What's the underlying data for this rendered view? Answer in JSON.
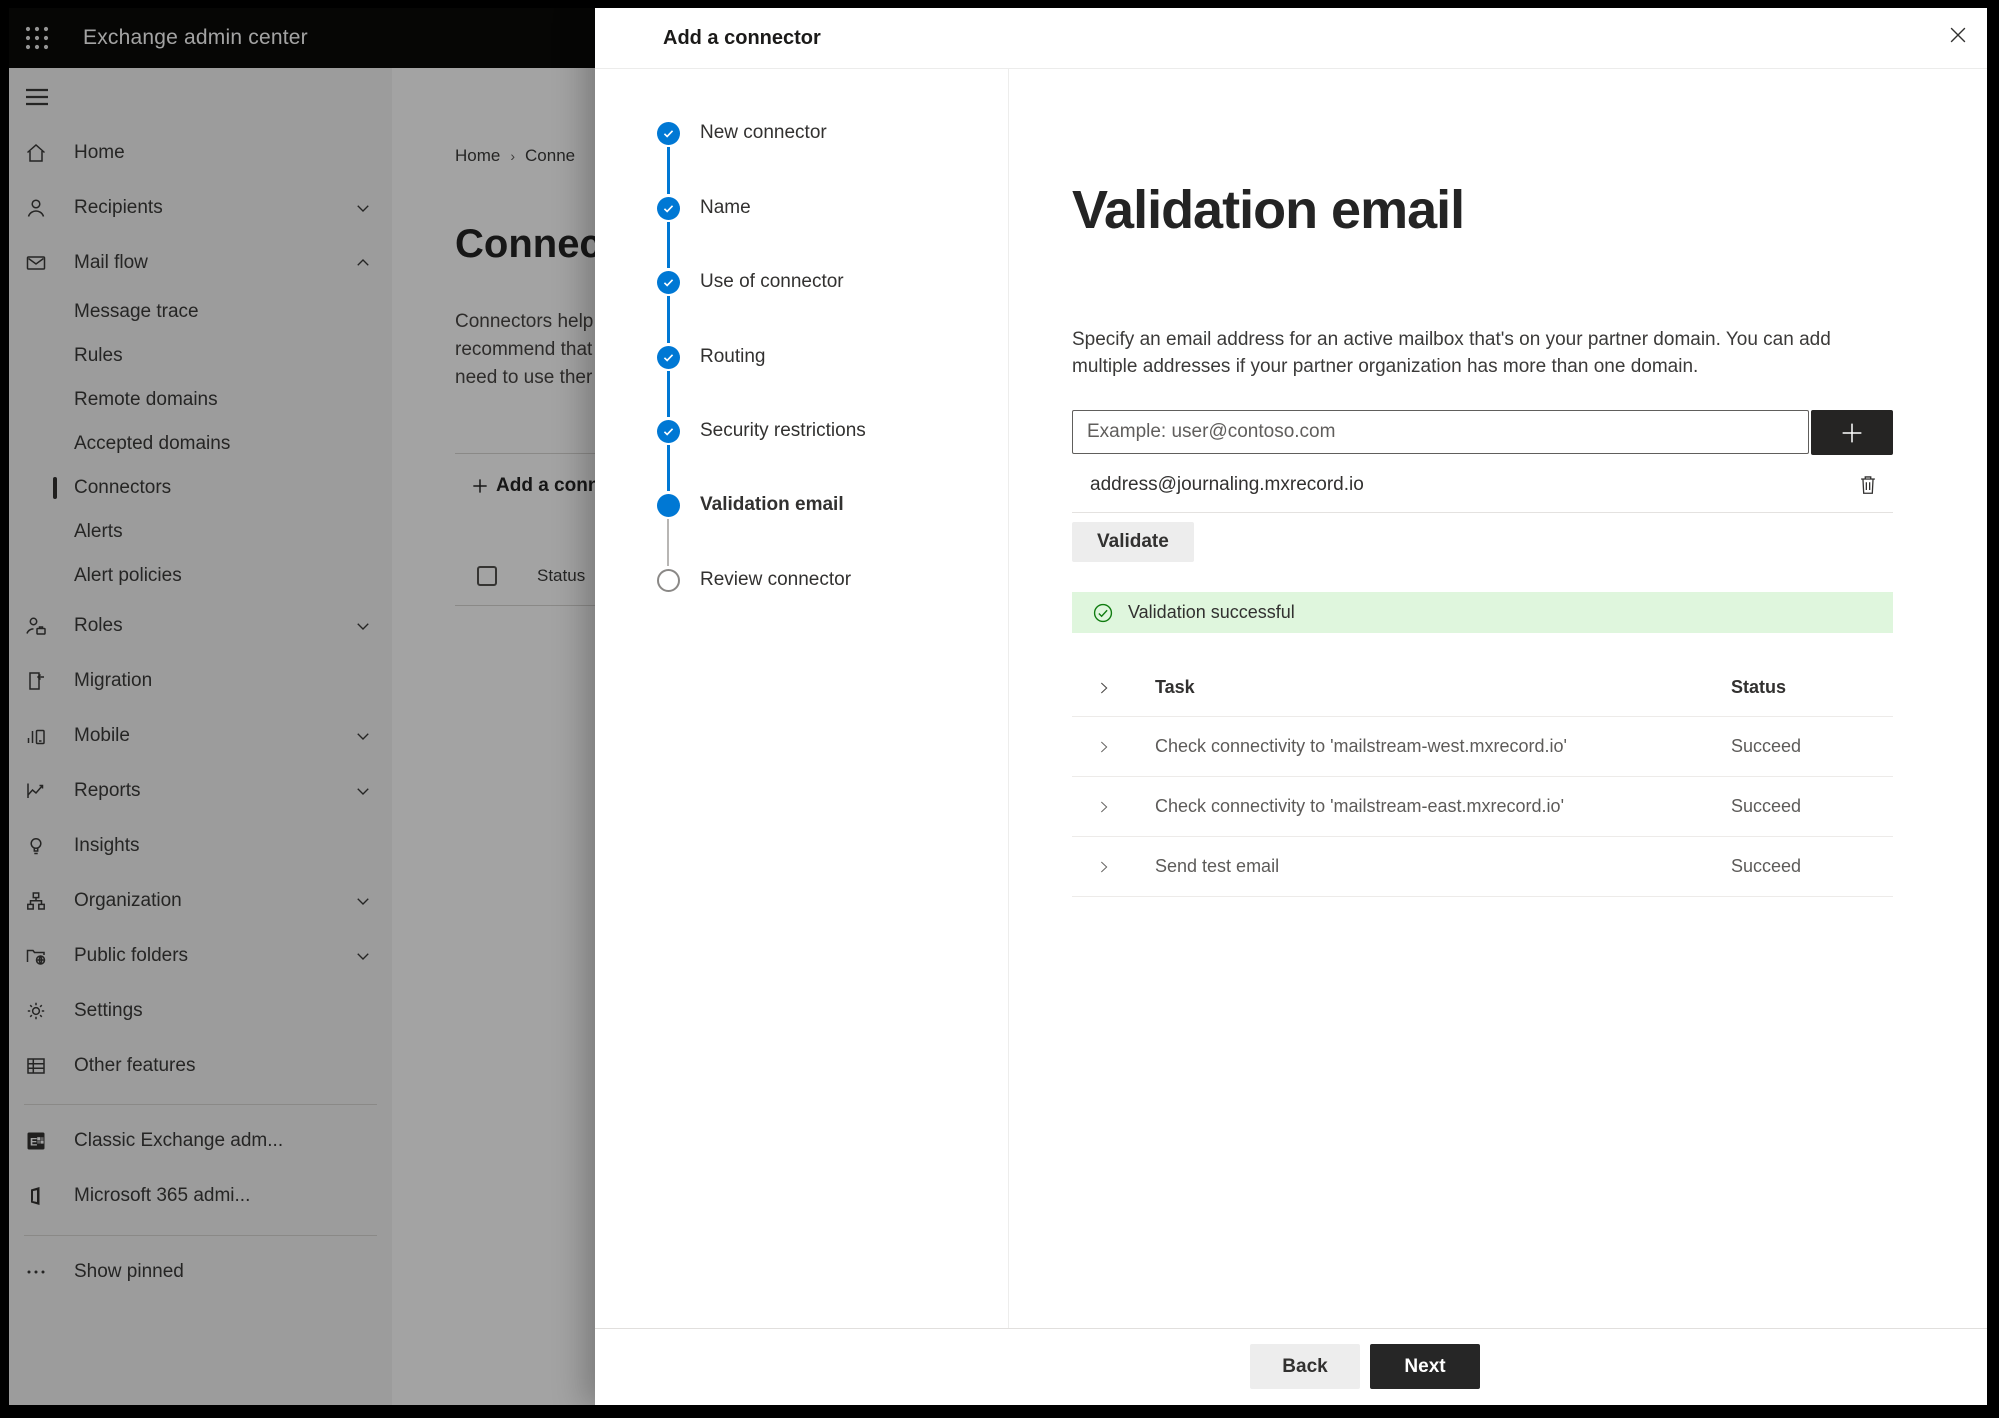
{
  "header": {
    "app_title": "Exchange admin center"
  },
  "breadcrumb": {
    "home": "Home",
    "current": "Conne"
  },
  "backdrop": {
    "page_title": "Connect",
    "intro_lines": [
      "Connectors help",
      "recommend that",
      "need to use ther"
    ],
    "add_button_label": "Add a conn",
    "list_header": "Status"
  },
  "sidebar": {
    "items": [
      {
        "label": "Home"
      },
      {
        "label": "Recipients",
        "chevron": "down"
      },
      {
        "label": "Mail flow",
        "chevron": "up"
      },
      {
        "label": "Message trace"
      },
      {
        "label": "Rules"
      },
      {
        "label": "Remote domains"
      },
      {
        "label": "Accepted domains"
      },
      {
        "label": "Connectors",
        "selected": true
      },
      {
        "label": "Alerts"
      },
      {
        "label": "Alert policies"
      },
      {
        "label": "Roles",
        "chevron": "down"
      },
      {
        "label": "Migration"
      },
      {
        "label": "Mobile",
        "chevron": "down"
      },
      {
        "label": "Reports",
        "chevron": "down"
      },
      {
        "label": "Insights"
      },
      {
        "label": "Organization",
        "chevron": "down"
      },
      {
        "label": "Public folders",
        "chevron": "down"
      },
      {
        "label": "Settings"
      },
      {
        "label": "Other features"
      }
    ],
    "footer_items": [
      {
        "label": "Classic Exchange adm..."
      },
      {
        "label": "Microsoft 365 admi..."
      },
      {
        "label": "Show pinned"
      }
    ]
  },
  "dialog": {
    "title": "Add a connector",
    "steps": [
      {
        "label": "New connector",
        "state": "complete"
      },
      {
        "label": "Name",
        "state": "complete"
      },
      {
        "label": "Use of connector",
        "state": "complete"
      },
      {
        "label": "Routing",
        "state": "complete"
      },
      {
        "label": "Security restrictions",
        "state": "complete"
      },
      {
        "label": "Validation email",
        "state": "current"
      },
      {
        "label": "Review connector",
        "state": "upcoming"
      }
    ],
    "heading": "Validation email",
    "description_lines": [
      "Specify an email address for an active mailbox that's on your partner domain. You can add",
      "multiple addresses if your partner organization has more than one domain."
    ],
    "email_placeholder": "Example: user@contoso.com",
    "added_address": "address@journaling.mxrecord.io",
    "validate_label": "Validate",
    "banner_text": "Validation successful",
    "table": {
      "task_header": "Task",
      "status_header": "Status",
      "rows": [
        {
          "task": "Check connectivity to 'mailstream-west.mxrecord.io'",
          "status": "Succeed"
        },
        {
          "task": "Check connectivity to 'mailstream-east.mxrecord.io'",
          "status": "Succeed"
        },
        {
          "task": "Send test email",
          "status": "Succeed"
        }
      ]
    },
    "back_label": "Back",
    "next_label": "Next"
  },
  "colors": {
    "accent": "#0078d4",
    "success": "#107c10",
    "success_bg": "#dff6dd",
    "dark_button": "#252423",
    "header_bg": "#0a0a09"
  }
}
